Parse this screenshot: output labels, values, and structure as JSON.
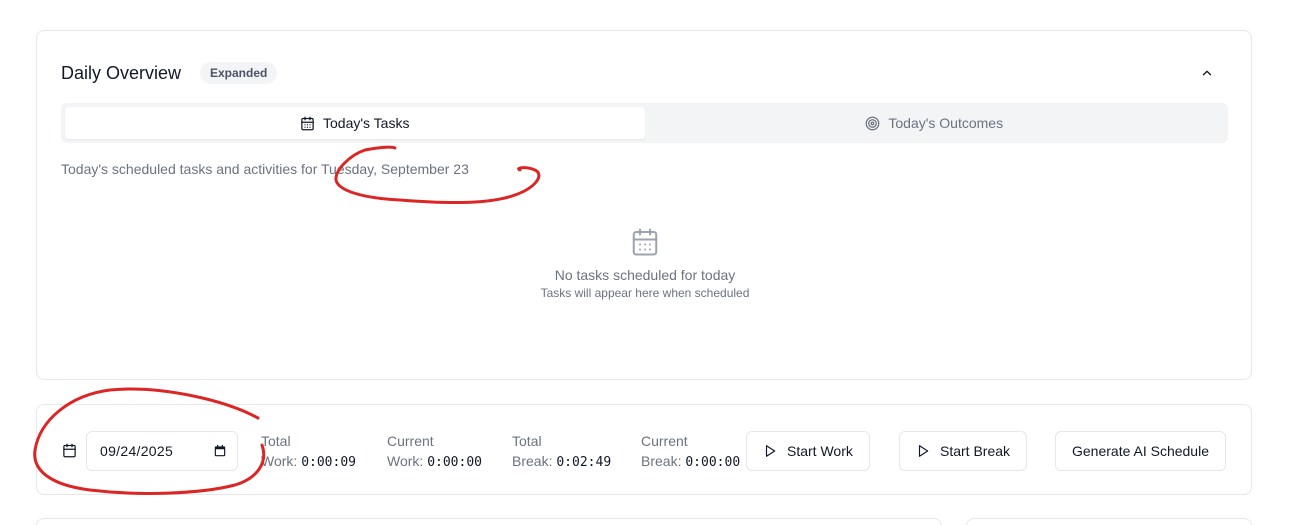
{
  "overview": {
    "title": "Daily Overview",
    "badge": "Expanded",
    "tabs": [
      {
        "label": "Today's Tasks",
        "icon": "calendar-icon",
        "active": true
      },
      {
        "label": "Today's Outcomes",
        "icon": "target-icon",
        "active": false
      }
    ],
    "description": "Today's scheduled tasks and activities for Tuesday, September 23",
    "empty_title": "No tasks scheduled for today",
    "empty_subtitle": "Tasks will appear here when scheduled"
  },
  "controls": {
    "date_value": "09/24/2025",
    "stats": [
      {
        "label_line1": "Total",
        "label_line2": "Work:",
        "value": "0:00:09"
      },
      {
        "label_line1": "Current",
        "label_line2": "Work:",
        "value": "0:00:00"
      },
      {
        "label_line1": "Total",
        "label_line2": "Break:",
        "value": "0:02:49"
      },
      {
        "label_line1": "Current",
        "label_line2": "Break:",
        "value": "0:00:00"
      }
    ],
    "buttons": {
      "start_work": "Start Work",
      "start_break": "Start Break",
      "generate_ai": "Generate AI Schedule"
    }
  },
  "colors": {
    "border": "#e5e7eb",
    "muted_text": "#6b7280",
    "annotation": "#dc2626"
  }
}
